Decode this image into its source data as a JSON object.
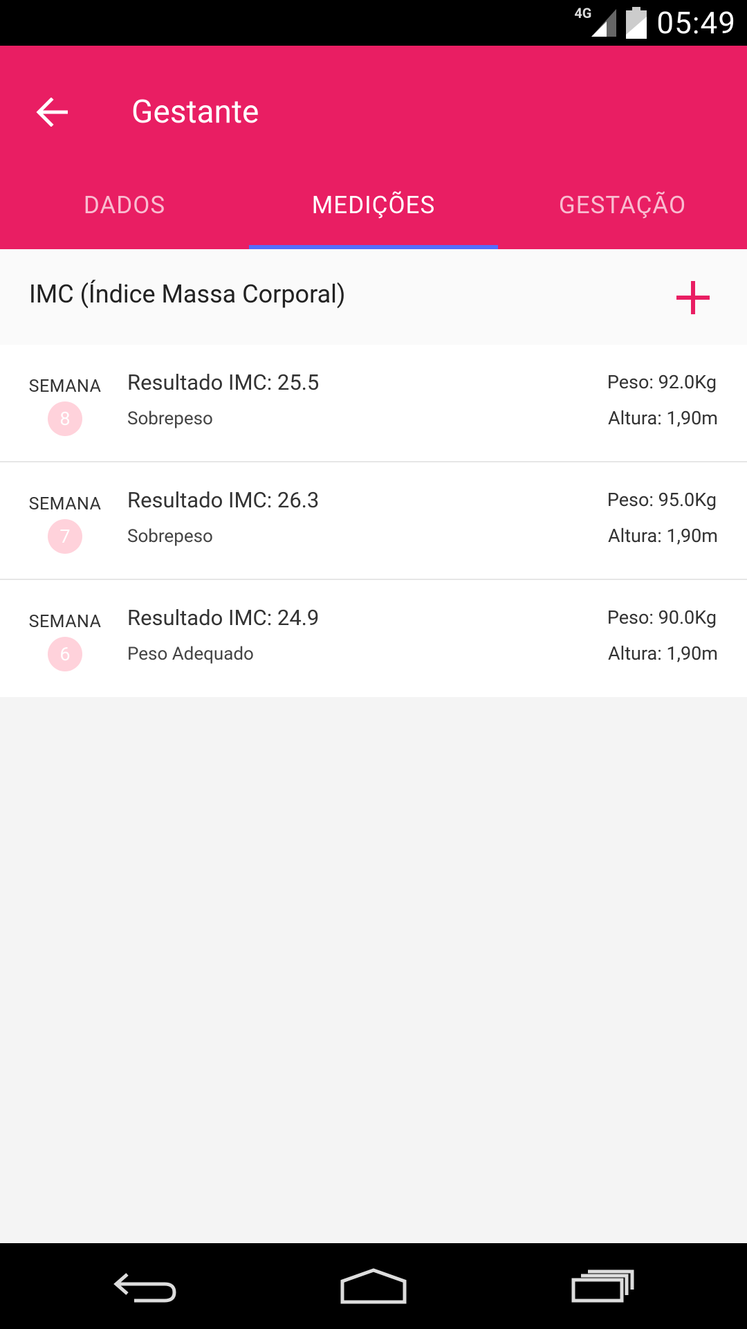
{
  "status_bar": {
    "network": "4G",
    "time": "05:49",
    "icons": [
      "signal-icon",
      "battery-icon"
    ]
  },
  "app_bar": {
    "title": "Gestante",
    "back_icon": "arrow-left-icon"
  },
  "tabs": [
    {
      "label": "DADOS",
      "active": false
    },
    {
      "label": "MEDIÇÕES",
      "active": true
    },
    {
      "label": "GESTAÇÃO",
      "active": false
    }
  ],
  "section": {
    "title": "IMC (Índice Massa Corporal)",
    "add_icon": "plus-icon"
  },
  "measurements": [
    {
      "week_label": "SEMANA",
      "week": "8",
      "result": "Resultado IMC: 25.5",
      "status": "Sobrepeso",
      "peso": "Peso: 92.0Kg",
      "altura": "Altura: 1,90m"
    },
    {
      "week_label": "SEMANA",
      "week": "7",
      "result": "Resultado IMC: 26.3",
      "status": "Sobrepeso",
      "peso": "Peso: 95.0Kg",
      "altura": "Altura: 1,90m"
    },
    {
      "week_label": "SEMANA",
      "week": "6",
      "result": "Resultado IMC: 24.9",
      "status": "Peso Adequado",
      "peso": "Peso: 90.0Kg",
      "altura": "Altura: 1,90m"
    }
  ],
  "colors": {
    "primary": "#e91e63",
    "tab_indicator": "#536dfe",
    "badge": "#ffd2db"
  },
  "nav_bar": {
    "icons": [
      "back-nav-icon",
      "home-nav-icon",
      "recents-nav-icon"
    ]
  }
}
